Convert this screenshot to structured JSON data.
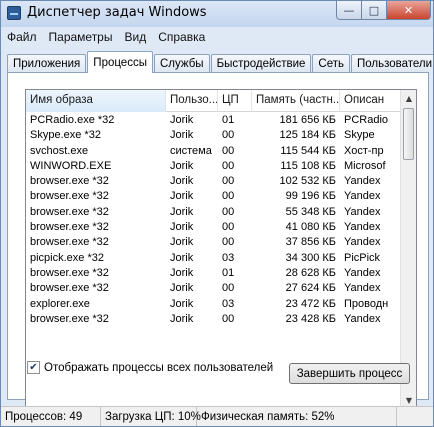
{
  "window": {
    "title": "Диспетчер задач Windows"
  },
  "menu": [
    "Файл",
    "Параметры",
    "Вид",
    "Справка"
  ],
  "tabs": [
    "Приложения",
    "Процессы",
    "Службы",
    "Быстродействие",
    "Сеть",
    "Пользователи"
  ],
  "active_tab": "Процессы",
  "columns": [
    "Имя образа",
    "Пользо...",
    "ЦП",
    "Память (частн...",
    "Описан"
  ],
  "sorted_column": "Имя образа",
  "rows": [
    {
      "name": "PCRadio.exe *32",
      "user": "Jorik",
      "cpu": "01",
      "mem": "181 656 КБ",
      "desc": "PCRadio"
    },
    {
      "name": "Skype.exe *32",
      "user": "Jorik",
      "cpu": "00",
      "mem": "125 184 КБ",
      "desc": "Skype"
    },
    {
      "name": "svchost.exe",
      "user": "система",
      "cpu": "00",
      "mem": "115 544 КБ",
      "desc": "Хост-пр"
    },
    {
      "name": "WINWORD.EXE",
      "user": "Jorik",
      "cpu": "00",
      "mem": "115 108 КБ",
      "desc": "Microsof"
    },
    {
      "name": "browser.exe *32",
      "user": "Jorik",
      "cpu": "00",
      "mem": "102 532 КБ",
      "desc": "Yandex"
    },
    {
      "name": "browser.exe *32",
      "user": "Jorik",
      "cpu": "00",
      "mem": "99 196 КБ",
      "desc": "Yandex"
    },
    {
      "name": "browser.exe *32",
      "user": "Jorik",
      "cpu": "00",
      "mem": "55 348 КБ",
      "desc": "Yandex"
    },
    {
      "name": "browser.exe *32",
      "user": "Jorik",
      "cpu": "00",
      "mem": "41 080 КБ",
      "desc": "Yandex"
    },
    {
      "name": "browser.exe *32",
      "user": "Jorik",
      "cpu": "00",
      "mem": "37 856 КБ",
      "desc": "Yandex"
    },
    {
      "name": "picpick.exe *32",
      "user": "Jorik",
      "cpu": "03",
      "mem": "34 300 КБ",
      "desc": "PicPick"
    },
    {
      "name": "browser.exe *32",
      "user": "Jorik",
      "cpu": "01",
      "mem": "28 628 КБ",
      "desc": "Yandex"
    },
    {
      "name": "browser.exe *32",
      "user": "Jorik",
      "cpu": "00",
      "mem": "27 624 КБ",
      "desc": "Yandex"
    },
    {
      "name": "explorer.exe",
      "user": "Jorik",
      "cpu": "03",
      "mem": "23 472 КБ",
      "desc": "Проводн"
    },
    {
      "name": "browser.exe *32",
      "user": "Jorik",
      "cpu": "00",
      "mem": "23 428 КБ",
      "desc": "Yandex"
    }
  ],
  "show_all_label": "Отображать процессы всех пользователей",
  "show_all_checked": true,
  "end_process_label": "Завершить процесс",
  "status": {
    "processes": "Процессов: 49",
    "cpu": "Загрузка ЦП: 10%",
    "memory": "Физическая память: 52%"
  }
}
